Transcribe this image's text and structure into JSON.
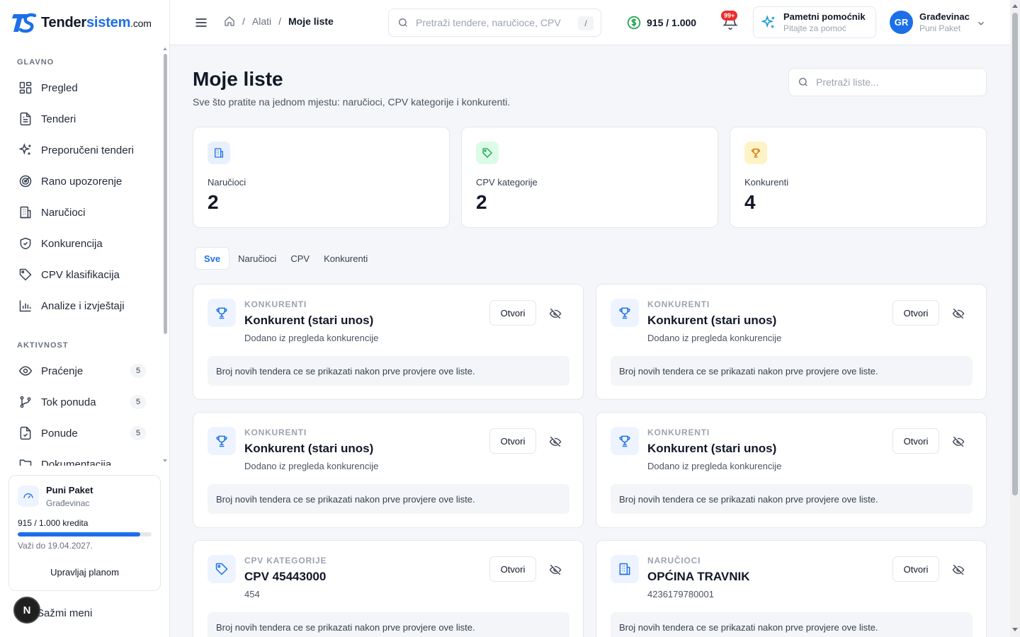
{
  "app": {
    "logo_main": "Tender",
    "logo_accent": "sistem",
    "logo_domain": ".com"
  },
  "sidebar": {
    "sections": [
      {
        "label": "GLAVNO"
      },
      {
        "label": "AKTIVNOST"
      }
    ],
    "main_items": [
      {
        "label": "Pregled",
        "icon": "dashboard-icon"
      },
      {
        "label": "Tenderi",
        "icon": "document-icon"
      },
      {
        "label": "Preporučeni tenderi",
        "icon": "sparkles-icon"
      },
      {
        "label": "Rano upozorenje",
        "icon": "radar-icon"
      },
      {
        "label": "Naručioci",
        "icon": "building-icon"
      },
      {
        "label": "Konkurencija",
        "icon": "shield-icon"
      },
      {
        "label": "CPV klasifikacija",
        "icon": "tag-icon"
      },
      {
        "label": "Analize i izvještaji",
        "icon": "bar-chart-icon"
      }
    ],
    "activity_items": [
      {
        "label": "Praćenje",
        "badge": "5",
        "icon": "eye-icon"
      },
      {
        "label": "Tok ponuda",
        "badge": "5",
        "icon": "git-branch-icon"
      },
      {
        "label": "Ponude",
        "badge": "5",
        "icon": "file-check-icon"
      },
      {
        "label": "Dokumentacija",
        "icon": "folder-icon"
      }
    ],
    "plan": {
      "name": "Puni Paket",
      "type": "Građevinac",
      "credits": "915 / 1.000 kredita",
      "credits_fraction": 0.915,
      "valid_until": "Važi do 19.04.2027.",
      "manage_label": "Upravljaj planom"
    },
    "collapse_label": "Sažmi meni",
    "fab_letter": "N"
  },
  "header": {
    "breadcrumb": [
      "Alati",
      "Moje liste"
    ],
    "search_placeholder": "Pretraži tendere, naručioce, CPV",
    "search_shortcut": "/",
    "credits": "915 / 1.000",
    "notifications_badge": "99+",
    "assistant_title": "Pametni pomoćnik",
    "assistant_subtitle": "Pitajte za pomoć",
    "user_initials": "GR",
    "user_name": "Građevinac",
    "user_plan": "Puni Paket"
  },
  "page": {
    "title": "Moje liste",
    "subtitle": "Sve što pratite na jednom mjestu: naručioci, CPV kategorije i konkurenti.",
    "search_placeholder": "Pretraži liste..."
  },
  "stats": [
    {
      "label": "Naručioci",
      "value": "2",
      "icon": "building-icon",
      "color": "#e8f0fe",
      "icon_color": "#1d6fe8"
    },
    {
      "label": "CPV kategorije",
      "value": "2",
      "icon": "tag-icon",
      "color": "#dcfce7",
      "icon_color": "#16a34a"
    },
    {
      "label": "Konkurenti",
      "value": "4",
      "icon": "trophy-icon",
      "color": "#fef3c7",
      "icon_color": "#d97706"
    }
  ],
  "tabs": [
    "Sve",
    "Naručioci",
    "CPV",
    "Konkurenti"
  ],
  "active_tab": "Sve",
  "cards": [
    {
      "type": "KONKURENTI",
      "title": "Konkurent (stari unos)",
      "subtitle": "Dodano iz pregleda konkurencije",
      "note": "Broj novih tendera ce se prikazati nakon prve provjere ove liste.",
      "open_label": "Otvori",
      "icon": "trophy-icon"
    },
    {
      "type": "KONKURENTI",
      "title": "Konkurent (stari unos)",
      "subtitle": "Dodano iz pregleda konkurencije",
      "note": "Broj novih tendera ce se prikazati nakon prve provjere ove liste.",
      "open_label": "Otvori",
      "icon": "trophy-icon"
    },
    {
      "type": "KONKURENTI",
      "title": "Konkurent (stari unos)",
      "subtitle": "Dodano iz pregleda konkurencije",
      "note": "Broj novih tendera ce se prikazati nakon prve provjere ove liste.",
      "open_label": "Otvori",
      "icon": "trophy-icon"
    },
    {
      "type": "KONKURENTI",
      "title": "Konkurent (stari unos)",
      "subtitle": "Dodano iz pregleda konkurencije",
      "note": "Broj novih tendera ce se prikazati nakon prve provjere ove liste.",
      "open_label": "Otvori",
      "icon": "trophy-icon"
    },
    {
      "type": "CPV KATEGORIJE",
      "title": "CPV 45443000",
      "subtitle": "454",
      "note": "Broj novih tendera ce se prikazati nakon prve provjere ove liste.",
      "open_label": "Otvori",
      "icon": "tag-icon"
    },
    {
      "type": "NARUČIOCI",
      "title": "OPĆINA TRAVNIK",
      "subtitle": "4236179780001",
      "note": "Broj novih tendera ce se prikazati nakon prve provjere ove liste.",
      "open_label": "Otvori",
      "icon": "building-icon"
    }
  ],
  "colors": {
    "accent": "#1d6fe8",
    "danger": "#ef2b2b",
    "success": "#16a34a"
  }
}
